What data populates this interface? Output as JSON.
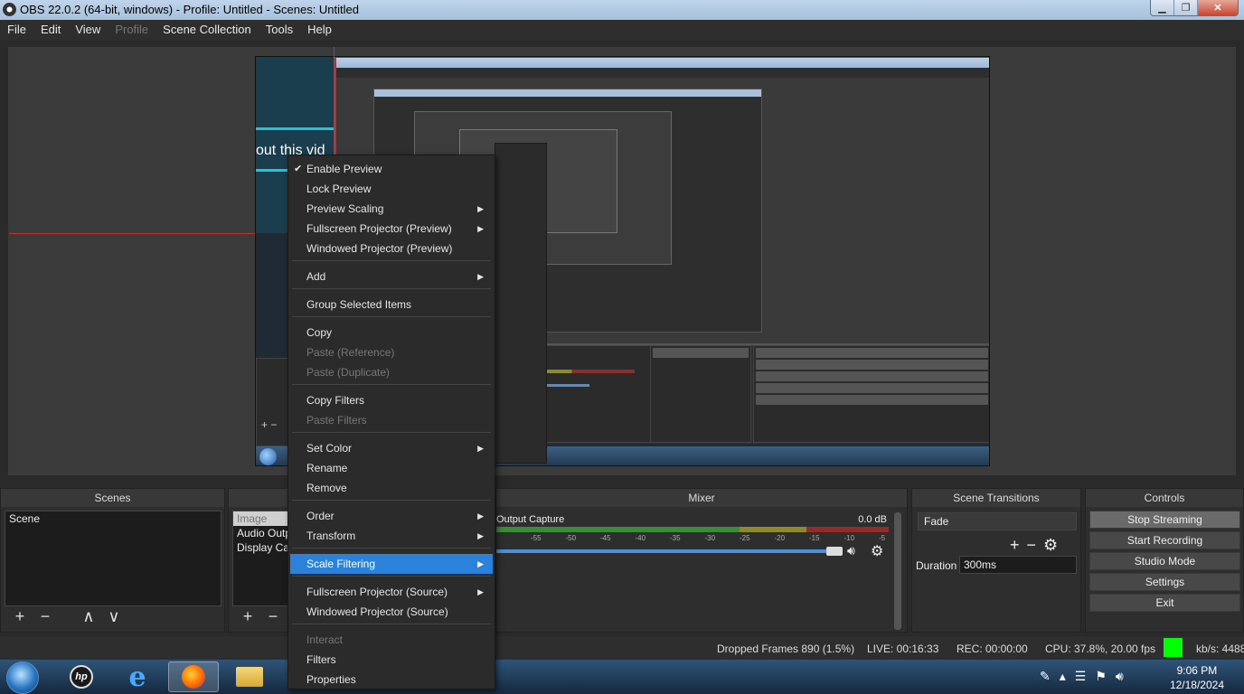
{
  "window": {
    "title": "OBS 22.0.2 (64-bit, windows) - Profile: Untitled - Scenes: Untitled"
  },
  "menubar": {
    "items": [
      {
        "label": "File",
        "disabled": false
      },
      {
        "label": "Edit",
        "disabled": false
      },
      {
        "label": "View",
        "disabled": false
      },
      {
        "label": "Profile",
        "disabled": true
      },
      {
        "label": "Scene Collection",
        "disabled": false
      },
      {
        "label": "Tools",
        "disabled": false
      },
      {
        "label": "Help",
        "disabled": false
      }
    ]
  },
  "preview": {
    "overlay_text": "out this vid"
  },
  "docks": {
    "scenes": {
      "title": "Scenes",
      "items": [
        "Scene"
      ]
    },
    "sources": {
      "items": [
        "Image",
        "Audio Outpu",
        "Display Captu"
      ]
    },
    "mixer": {
      "title": "Mixer",
      "source_name": "Output Capture",
      "level": "0.0 dB",
      "ticks": [
        "-55",
        "-50",
        "-45",
        "-40",
        "-35",
        "-30",
        "-25",
        "-20",
        "-15",
        "-10",
        "-5",
        "0"
      ],
      "volume_fraction": 0.86
    },
    "scene_transitions": {
      "title": "Scene Transitions",
      "selected": "Fade",
      "duration_label": "Duration",
      "duration_value": "300ms"
    },
    "controls": {
      "title": "Controls",
      "buttons": [
        "Stop Streaming",
        "Start Recording",
        "Studio Mode",
        "Settings",
        "Exit"
      ]
    }
  },
  "statusbar": {
    "dropped": "Dropped Frames 890 (1.5%)",
    "live": "LIVE: 00:16:33",
    "rec": "REC: 00:00:00",
    "cpu": "CPU: 37.8%, 20.00 fps",
    "kbs": "kb/s: 4488",
    "indicator_color": "#00ff00"
  },
  "context_menu": {
    "items": [
      {
        "label": "Enable Preview",
        "checked": true,
        "submenu": false,
        "disabled": false
      },
      {
        "label": "Lock Preview",
        "checked": false,
        "submenu": false,
        "disabled": false
      },
      {
        "label": "Preview Scaling",
        "checked": false,
        "submenu": true,
        "disabled": false
      },
      {
        "label": "Fullscreen Projector (Preview)",
        "checked": false,
        "submenu": true,
        "disabled": false
      },
      {
        "label": "Windowed Projector (Preview)",
        "checked": false,
        "submenu": false,
        "disabled": false
      },
      {
        "label": "Add",
        "checked": false,
        "submenu": true,
        "disabled": false
      },
      {
        "label": "Group Selected Items",
        "checked": false,
        "submenu": false,
        "disabled": false
      },
      {
        "label": "Copy",
        "checked": false,
        "submenu": false,
        "disabled": false
      },
      {
        "label": "Paste (Reference)",
        "checked": false,
        "submenu": false,
        "disabled": true
      },
      {
        "label": "Paste (Duplicate)",
        "checked": false,
        "submenu": false,
        "disabled": true
      },
      {
        "label": "Copy Filters",
        "checked": false,
        "submenu": false,
        "disabled": false
      },
      {
        "label": "Paste Filters",
        "checked": false,
        "submenu": false,
        "disabled": true
      },
      {
        "label": "Set Color",
        "checked": false,
        "submenu": true,
        "disabled": false
      },
      {
        "label": "Rename",
        "checked": false,
        "submenu": false,
        "disabled": false
      },
      {
        "label": "Remove",
        "checked": false,
        "submenu": false,
        "disabled": false
      },
      {
        "label": "Order",
        "checked": false,
        "submenu": true,
        "disabled": false
      },
      {
        "label": "Transform",
        "checked": false,
        "submenu": true,
        "disabled": false
      },
      {
        "label": "Scale Filtering",
        "checked": false,
        "submenu": true,
        "disabled": false,
        "highlighted": true
      },
      {
        "label": "Fullscreen Projector (Source)",
        "checked": false,
        "submenu": true,
        "disabled": false
      },
      {
        "label": "Windowed Projector (Source)",
        "checked": false,
        "submenu": false,
        "disabled": false
      },
      {
        "label": "Interact",
        "checked": false,
        "submenu": false,
        "disabled": true
      },
      {
        "label": "Filters",
        "checked": false,
        "submenu": false,
        "disabled": false
      },
      {
        "label": "Properties",
        "checked": false,
        "submenu": false,
        "disabled": false
      }
    ]
  },
  "taskbar": {
    "apps": [
      "hp-icon",
      "internet-explorer-icon",
      "firefox-icon",
      "file-explorer-icon"
    ],
    "time": "9:06 PM",
    "date": "12/18/2024"
  }
}
